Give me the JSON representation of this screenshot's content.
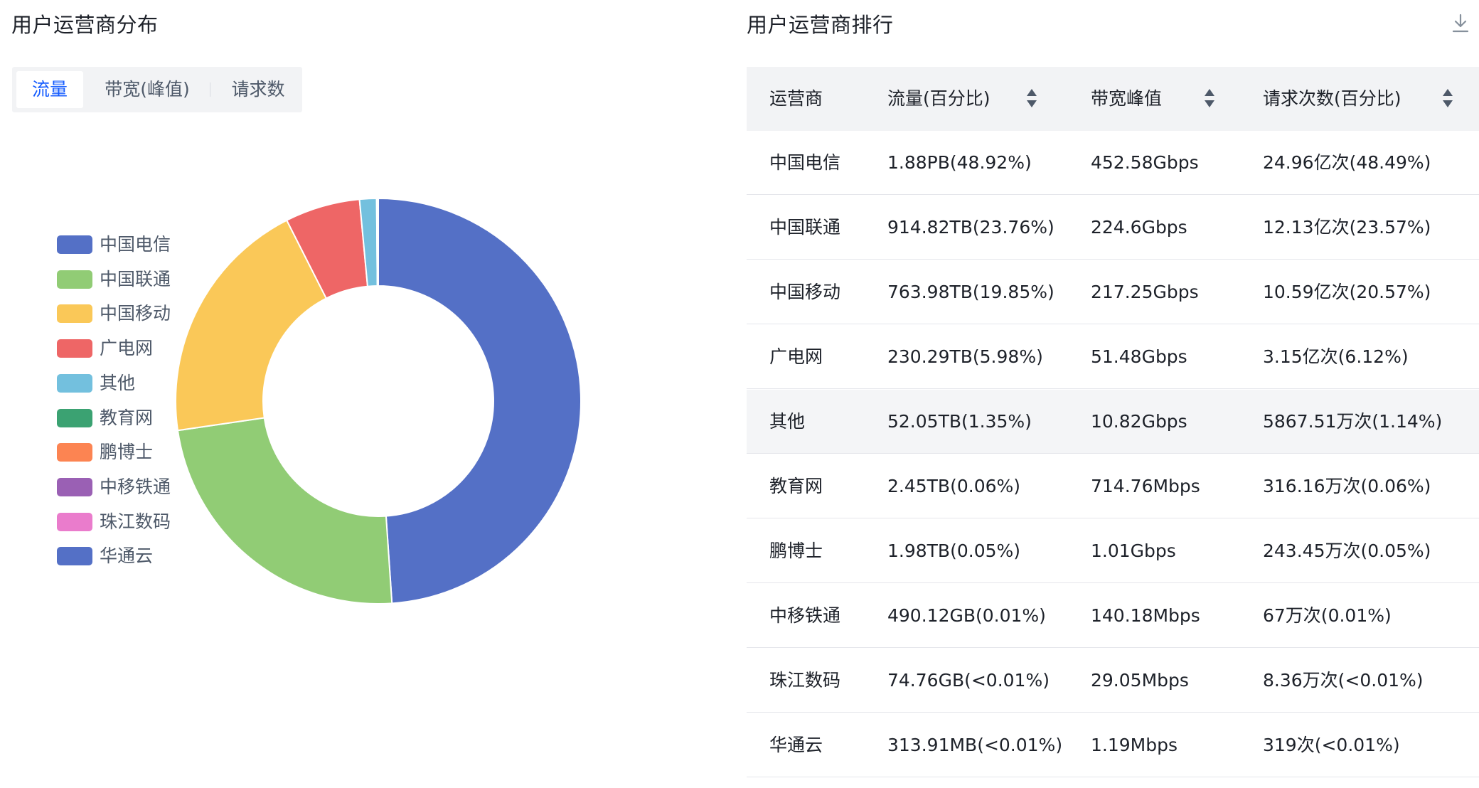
{
  "distribution": {
    "title": "用户运营商分布",
    "tabs": [
      "流量",
      "带宽(峰值)",
      "请求数"
    ],
    "active_tab": 0
  },
  "ranking": {
    "title": "用户运营商排行",
    "headers": [
      "运营商",
      "流量(百分比)",
      "带宽峰值",
      "请求次数(百分比)"
    ],
    "rows": [
      [
        "中国电信",
        "1.88PB(48.92%)",
        "452.58Gbps",
        "24.96亿次(48.49%)"
      ],
      [
        "中国联通",
        "914.82TB(23.76%)",
        "224.6Gbps",
        "12.13亿次(23.57%)"
      ],
      [
        "中国移动",
        "763.98TB(19.85%)",
        "217.25Gbps",
        "10.59亿次(20.57%)"
      ],
      [
        "广电网",
        "230.29TB(5.98%)",
        "51.48Gbps",
        "3.15亿次(6.12%)"
      ],
      [
        "其他",
        "52.05TB(1.35%)",
        "10.82Gbps",
        "5867.51万次(1.14%)"
      ],
      [
        "教育网",
        "2.45TB(0.06%)",
        "714.76Mbps",
        "316.16万次(0.06%)"
      ],
      [
        "鹏博士",
        "1.98TB(0.05%)",
        "1.01Gbps",
        "243.45万次(0.05%)"
      ],
      [
        "中移铁通",
        "490.12GB(0.01%)",
        "140.18Mbps",
        "67万次(0.01%)"
      ],
      [
        "珠江数码",
        "74.76GB(<0.01%)",
        "29.05Mbps",
        "8.36万次(<0.01%)"
      ],
      [
        "华通云",
        "313.91MB(<0.01%)",
        "1.19Mbps",
        "319次(<0.01%)"
      ]
    ],
    "hover_row": 4
  },
  "chart_data": {
    "type": "pie",
    "donut": true,
    "legend_position": "left",
    "title": "",
    "categories": [
      "中国电信",
      "中国联通",
      "中国移动",
      "广电网",
      "其他",
      "教育网",
      "鹏博士",
      "中移铁通",
      "珠江数码",
      "华通云"
    ],
    "values": [
      48.92,
      23.76,
      19.85,
      5.98,
      1.35,
      0.06,
      0.05,
      0.01,
      0.005,
      0.005
    ],
    "colors": [
      "#5470c6",
      "#91cc75",
      "#fac858",
      "#ee6666",
      "#73c0de",
      "#3ba272",
      "#fc8452",
      "#9a60b4",
      "#ea7ccc",
      "#5470c6"
    ]
  }
}
